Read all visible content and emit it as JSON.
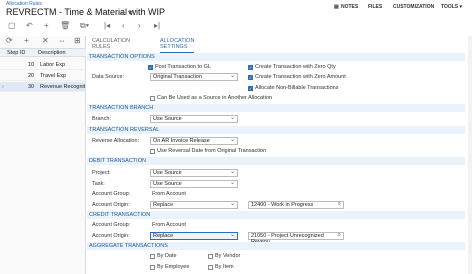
{
  "breadcrumb": "Allocation Rules",
  "title": "REVRECTM - Time & Material with WIP",
  "top_links": {
    "notes": "NOTES",
    "files": "FILES",
    "customization": "CUSTOMIZATION",
    "tools": "TOOLS ▾"
  },
  "grid": {
    "headers": {
      "step": "Step ID",
      "desc": "Description"
    },
    "rows": [
      {
        "step": "10",
        "desc": "Labor Exp"
      },
      {
        "step": "20",
        "desc": "Travel Exp"
      },
      {
        "step": "30",
        "desc": "Revenue Recognit"
      }
    ]
  },
  "tabs": {
    "calc": "CALCULATION RULES",
    "alloc": "ALLOCATION SETTINGS"
  },
  "sections": {
    "options": "TRANSACTION OPTIONS",
    "branch": "TRANSACTION BRANCH",
    "reversal": "TRANSACTION REVERSAL",
    "debit": "DEBIT TRANSACTION",
    "credit": "CREDIT TRANSACTION",
    "aggregate": "AGGREGATE TRANSACTIONS"
  },
  "options": {
    "post_gl": "Post Transaction to GL",
    "data_source_label": "Data Source:",
    "data_source": "Original Transaction",
    "zero_qty": "Create Transaction with Zero Qty",
    "zero_amount": "Create Transaction with Zero Amount",
    "non_billable": "Allocate Non-Billable Transactions",
    "can_be_source": "Can Be Used as a Source in Another Allocation"
  },
  "branch": {
    "label": "Branch:",
    "value": "Use Source"
  },
  "reversal": {
    "label": "Reverse Allocation:",
    "value": "On AR Invoice Release",
    "use_reversal_date": "Use Reversal Date from Original Transaction"
  },
  "debit": {
    "project_label": "Project:",
    "project": "Use Source",
    "task_label": "Task:",
    "task": "Use Source",
    "group_label": "Account Group:",
    "group": "From Account",
    "origin_label": "Account Origin:",
    "origin": "Replace",
    "account": "12400 - Work in Progress"
  },
  "credit": {
    "group_label": "Account Group:",
    "group": "From Account",
    "origin_label": "Account Origin:",
    "origin": "Replace",
    "account": "21050 - Project Unrecognized Revenu"
  },
  "aggregate": {
    "by_date": "By Date",
    "by_vendor": "By Vendor",
    "by_employee": "By Employee",
    "by_item": "By Item"
  }
}
